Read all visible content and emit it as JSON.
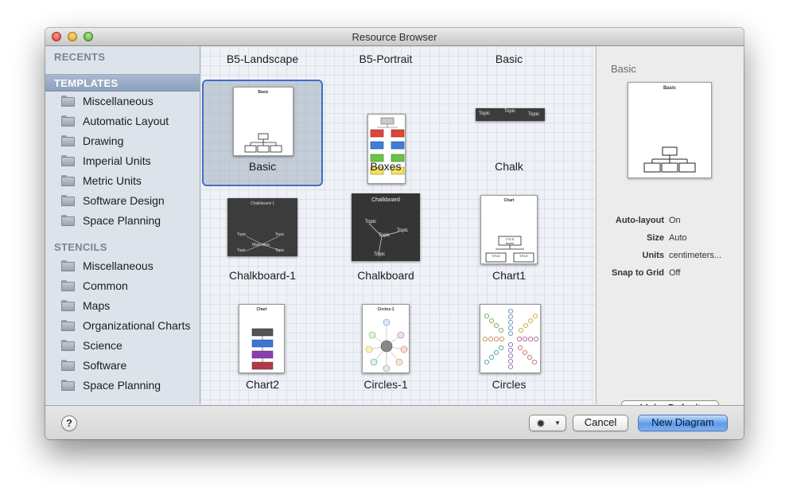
{
  "window": {
    "title": "Resource Browser"
  },
  "sidebar": {
    "recents_label": "RECENTS",
    "templates_label": "TEMPLATES",
    "templates": [
      {
        "label": "Miscellaneous"
      },
      {
        "label": "Automatic Layout"
      },
      {
        "label": "Drawing"
      },
      {
        "label": "Imperial Units"
      },
      {
        "label": "Metric Units"
      },
      {
        "label": "Software Design"
      },
      {
        "label": "Space Planning"
      }
    ],
    "stencils_label": "STENCILS",
    "stencils": [
      {
        "label": "Miscellaneous"
      },
      {
        "label": "Common"
      },
      {
        "label": "Maps"
      },
      {
        "label": "Organizational Charts"
      },
      {
        "label": "Science"
      },
      {
        "label": "Software"
      },
      {
        "label": "Space Planning"
      }
    ]
  },
  "grid": {
    "column_headers": [
      "B5-Landscape",
      "B5-Portrait",
      "Basic"
    ],
    "templates": [
      {
        "label": "Basic",
        "selected": true
      },
      {
        "label": "Boxes"
      },
      {
        "label": "Chalk"
      },
      {
        "label": "Chalkboard-1"
      },
      {
        "label": "Chalkboard"
      },
      {
        "label": "Chart1"
      },
      {
        "label": "Chart2"
      },
      {
        "label": "Circles-1"
      },
      {
        "label": "Circles"
      }
    ],
    "thumb_text": {
      "basic_title": "Basic",
      "topic": "Topic",
      "chalkboard1_title": "Chalkboard-1",
      "chalkboard_title": "Chalkboard",
      "main_idea": "Main Idea",
      "chart_title": "Chart",
      "title_box": "TITLE",
      "name": "Name",
      "circles_title": "Circles-1"
    }
  },
  "inspector": {
    "title": "Basic",
    "preview_title": "Basic",
    "properties": [
      {
        "label": "Auto-layout",
        "value": "On"
      },
      {
        "label": "Size",
        "value": "Auto"
      },
      {
        "label": "Units",
        "value": "centimeters..."
      },
      {
        "label": "Snap to Grid",
        "value": "Off"
      }
    ],
    "make_default_label": "Make Default"
  },
  "bottom": {
    "help_label": "?",
    "action_icon": "gear-icon",
    "cancel_label": "Cancel",
    "new_diagram_label": "New Diagram"
  },
  "colors": {
    "selection_border": "#3e6fc7",
    "sidebar_background": "#dde3ea",
    "primary_button": "#5d9ae8"
  }
}
